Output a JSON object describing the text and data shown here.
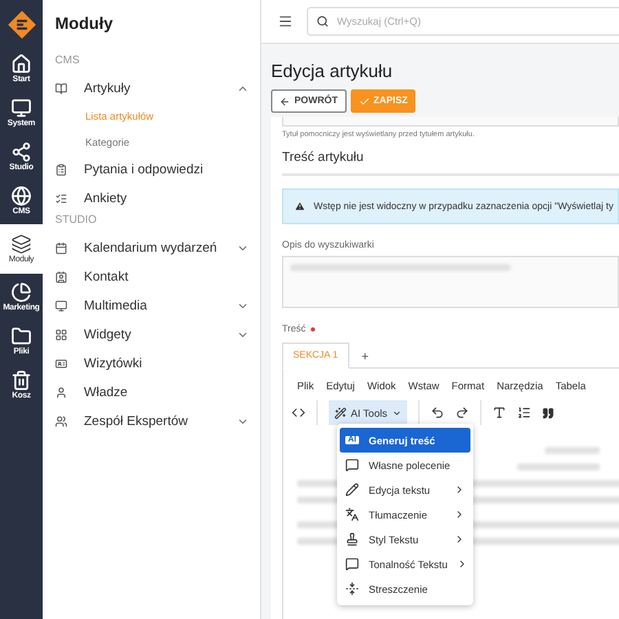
{
  "rail": [
    {
      "label": "Start",
      "selected": false
    },
    {
      "label": "System",
      "selected": false
    },
    {
      "label": "Studio",
      "selected": false
    },
    {
      "label": "CMS",
      "selected": false
    },
    {
      "label": "Moduły",
      "selected": true
    },
    {
      "label": "Marketing",
      "selected": false
    },
    {
      "label": "Pliki",
      "selected": false
    },
    {
      "label": "Kosz",
      "selected": false
    }
  ],
  "sidebar": {
    "title": "Moduły",
    "sections": [
      {
        "heading": "CMS",
        "items": [
          {
            "label": "Artykuły",
            "kind": "group",
            "expanded": true,
            "children": [
              {
                "label": "Lista artykułów",
                "selected": true
              },
              {
                "label": "Kategorie",
                "selected": false
              }
            ]
          },
          {
            "label": "Pytania i odpowiedzi",
            "kind": "link"
          },
          {
            "label": "Ankiety",
            "kind": "link"
          }
        ]
      },
      {
        "heading": "STUDIO",
        "items": [
          {
            "label": "Kalendarium wydarzeń",
            "kind": "group",
            "expanded": false
          },
          {
            "label": "Kontakt",
            "kind": "link"
          },
          {
            "label": "Multimedia",
            "kind": "group",
            "expanded": false
          },
          {
            "label": "Widgety",
            "kind": "group",
            "expanded": false
          },
          {
            "label": "Wizytówki",
            "kind": "link"
          },
          {
            "label": "Władze",
            "kind": "link"
          },
          {
            "label": "Zespół Ekspertów",
            "kind": "group",
            "expanded": false
          }
        ]
      }
    ]
  },
  "header": {
    "search": {
      "placeholder": "Wyszukaj (Ctrl+Q)"
    }
  },
  "page": {
    "title": "Edycja artykułu",
    "buttons": [
      {
        "label": "POWRÓT",
        "kind": "back"
      },
      {
        "label": "ZAPISZ",
        "kind": "save"
      }
    ],
    "helper": "Tytuł pomocniczy jest wyświetlany przed tytułem artykułu.",
    "section_title": "Treść artykułu",
    "alert": "Wstęp nie jest widoczny w przypadku zaznaczenia opcji \"Wyświetlaj ty",
    "description_label": "Opis do wyszukiwarki",
    "content_label": "Treść",
    "content_required": true,
    "tabs": [
      {
        "label": "SEKCJA 1",
        "selected": true
      }
    ],
    "add_tab": "+",
    "menubar": [
      "Plik",
      "Edytuj",
      "Widok",
      "Wstaw",
      "Format",
      "Narzędzia",
      "Tabela"
    ],
    "ai_button": "AI Tools",
    "ai_menu": [
      {
        "label": "Generuj treść",
        "badge": "AI",
        "submenu": false,
        "selected": true
      },
      {
        "label": "Własne polecenie",
        "submenu": false,
        "selected": false
      },
      {
        "label": "Edycja tekstu",
        "submenu": true,
        "selected": false
      },
      {
        "label": "Tłumaczenie",
        "submenu": true,
        "selected": false
      },
      {
        "label": "Styl Tekstu",
        "submenu": true,
        "selected": false
      },
      {
        "label": "Tonalność Tekstu",
        "submenu": true,
        "selected": false
      },
      {
        "label": "Streszczenie",
        "submenu": false,
        "selected": false
      }
    ]
  }
}
